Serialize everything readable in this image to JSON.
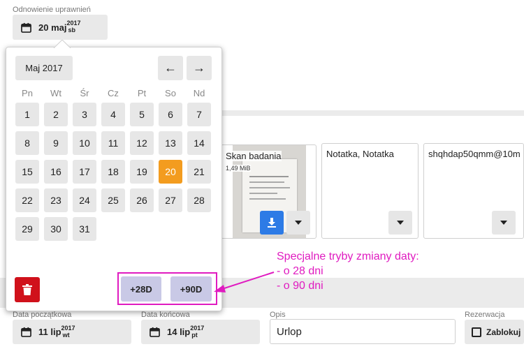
{
  "renewal": {
    "label": "Odnowienie uprawnień",
    "day": "20 maj",
    "year": "2017",
    "weekday": "sb"
  },
  "files": [
    {
      "name": "Skan badania",
      "size": "1,49 MiB"
    },
    {
      "note": "Notatka, Notatka"
    },
    {
      "email": "shqhdap50qmm@10m"
    }
  ],
  "calendar": {
    "month_label": "Maj 2017",
    "prev_label": "←",
    "next_label": "→",
    "weekdays": [
      "Pn",
      "Wt",
      "Śr",
      "Cz",
      "Pt",
      "So",
      "Nd"
    ],
    "days": [
      [
        "1",
        "2",
        "3",
        "4",
        "5",
        "6",
        "7"
      ],
      [
        "8",
        "9",
        "10",
        "11",
        "12",
        "13",
        "14"
      ],
      [
        "15",
        "16",
        "17",
        "18",
        "19",
        "20",
        "21"
      ],
      [
        "22",
        "23",
        "24",
        "25",
        "26",
        "27",
        "28"
      ],
      [
        "29",
        "30",
        "31"
      ]
    ],
    "selected": "20",
    "plus28_label": "+28D",
    "plus90_label": "+90D",
    "selected_color": "#f39c1f",
    "delete_color": "#d0111b"
  },
  "annotation": {
    "line1": "Specjalne tryby zmiany daty:",
    "line2": "- o 28 dni",
    "line3": "- o 90 dni",
    "color": "#e01bc0"
  },
  "bottom": {
    "start": {
      "label": "Data początkowa",
      "day": "11 lip",
      "year": "2017",
      "weekday": "wt"
    },
    "end": {
      "label": "Data końcowa",
      "day": "14 lip",
      "year": "2017",
      "weekday": "pt"
    },
    "desc": {
      "label": "Opis",
      "value": "Urlop"
    },
    "reservation": {
      "label": "Rezerwacja",
      "value": "Zablokuj"
    }
  }
}
